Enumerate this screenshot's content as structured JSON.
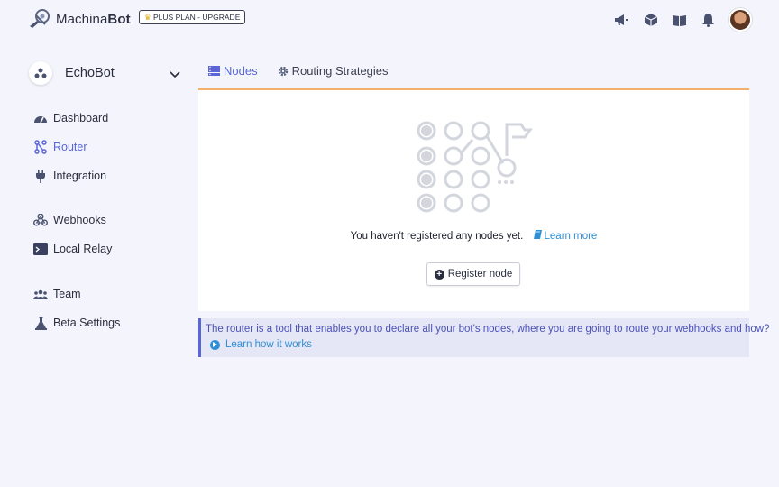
{
  "header": {
    "brand_light": "Machina",
    "brand_bold": "Bot",
    "plan_badge": "PLUS PLAN - UPGRADE",
    "icons": [
      "megaphone-icon",
      "box-icon",
      "book-icon",
      "bell-icon"
    ],
    "avatar": "user-avatar"
  },
  "sidebar": {
    "bot_name": "EchoBot",
    "items": [
      {
        "label": "Dashboard",
        "icon": "gauge-icon"
      },
      {
        "label": "Router",
        "icon": "router-icon"
      },
      {
        "label": "Integration",
        "icon": "plug-icon"
      },
      {
        "label": "Webhooks",
        "icon": "webhooks-icon"
      },
      {
        "label": "Local Relay",
        "icon": "terminal-icon"
      },
      {
        "label": "Team",
        "icon": "team-icon"
      },
      {
        "label": "Beta Settings",
        "icon": "flask-icon"
      }
    ],
    "active": "Router"
  },
  "tabs": [
    {
      "label": "Nodes",
      "icon": "server-icon"
    },
    {
      "label": "Routing Strategies",
      "icon": "gear-icon"
    }
  ],
  "empty_state": {
    "message": "You haven't registered any nodes yet.",
    "learn_more": "Learn more",
    "button": "Register node"
  },
  "info": {
    "text": "The router is a tool that enables you to declare all your bot's nodes, where you are going to route your webhooks and how?",
    "link": "Learn how it works"
  },
  "colors": {
    "accent": "#5866d6",
    "link": "#2e8fd6",
    "card_top_border": "#f4b06a",
    "background": "#f4f5fc"
  }
}
